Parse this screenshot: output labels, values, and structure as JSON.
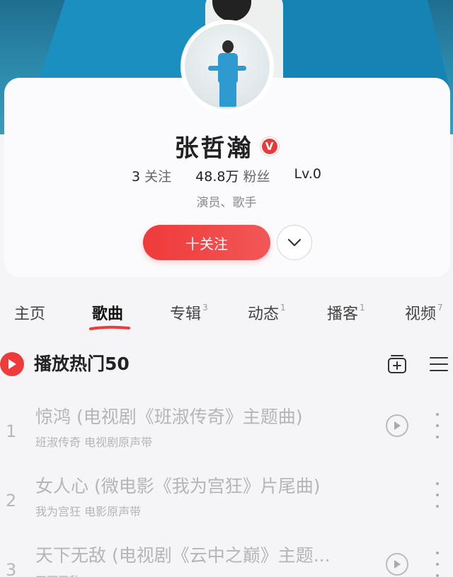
{
  "profile": {
    "name": "张哲瀚",
    "verified_badge": "V",
    "stats": [
      {
        "num": "3",
        "label": "关注"
      },
      {
        "num": "48.8万",
        "label": "粉丝"
      },
      {
        "num": "Lv.0",
        "label": ""
      }
    ],
    "role": "演员、歌手",
    "follow_label": "十关注",
    "more_icon": "chevron-down-icon"
  },
  "tabs": [
    {
      "label": "主页",
      "count": ""
    },
    {
      "label": "歌曲",
      "count": ""
    },
    {
      "label": "专辑",
      "count": "3"
    },
    {
      "label": "动态",
      "count": "1"
    },
    {
      "label": "播客",
      "count": "1"
    },
    {
      "label": "视频",
      "count": "7"
    }
  ],
  "active_tab": "歌曲",
  "list": {
    "title": "播放热门50",
    "icons": [
      "add-to-playlist-icon",
      "menu-icon"
    ]
  },
  "songs": [
    {
      "index": "1",
      "title": "惊鸿 (电视剧《班淑传奇》主题曲)",
      "subtitle": "班淑传奇 电视剧原声带"
    },
    {
      "index": "2",
      "title": "女人心 (微电影《我为宫狂》片尾曲)",
      "subtitle": "我为宫狂 电影原声带"
    },
    {
      "index": "3",
      "title": "天下无敌 (电视剧《云中之巅》主题...",
      "subtitle": "天下无敌"
    }
  ],
  "colors": {
    "accent": "#ef3b3b",
    "muted_text": "#b5b5b5",
    "card_bg": "#fbfbfd"
  }
}
